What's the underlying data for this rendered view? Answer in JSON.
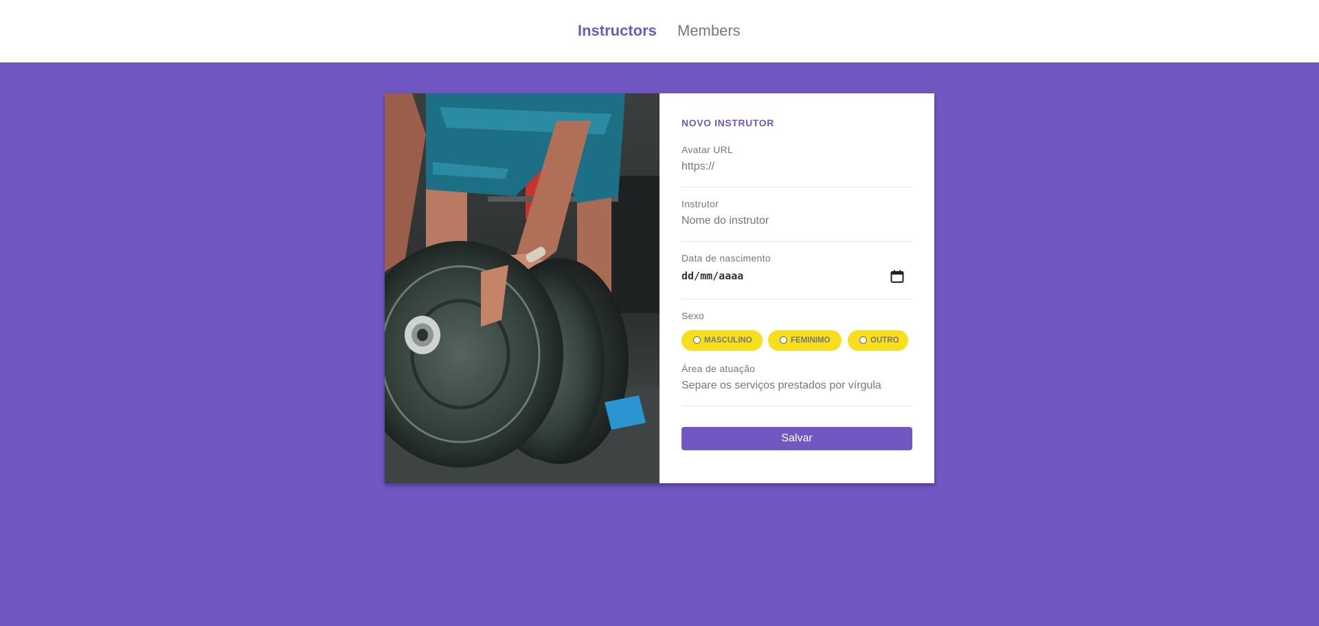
{
  "nav": {
    "items": [
      {
        "label": "Instructors",
        "active": true
      },
      {
        "label": "Members",
        "active": false
      }
    ]
  },
  "colors": {
    "accent": "#7157c1",
    "pill": "#f7df1e",
    "muted": "#777777"
  },
  "form": {
    "title": "NOVO INSTRUTOR",
    "avatar": {
      "label": "Avatar URL",
      "placeholder": "https://"
    },
    "instructor": {
      "label": "Instrutor",
      "placeholder": "Nome do instrutor"
    },
    "birth": {
      "label": "Data de nascimento",
      "value": "dd/mm/aaaa",
      "icon": "calendar-icon"
    },
    "gender": {
      "label": "Sexo",
      "options": [
        "MASCULINO",
        "FEMINIMO",
        "OUTRO"
      ]
    },
    "services": {
      "label": "Área de atuação",
      "placeholder": "Separe os serviços prestados por vírgula"
    },
    "submit_label": "Salvar"
  }
}
